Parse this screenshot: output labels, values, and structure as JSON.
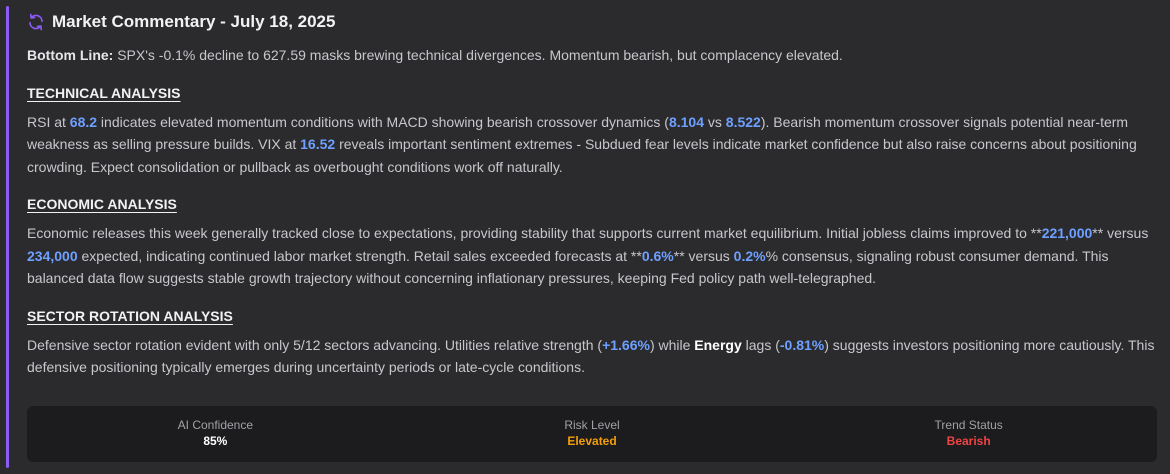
{
  "header": {
    "title": "Market Commentary - July 18, 2025",
    "icon": "refresh-icon",
    "icon_color": "#8b5cf6"
  },
  "bottom_line": {
    "label": "Bottom Line:",
    "text": " SPX's -0.1% decline to 627.59 masks brewing technical divergences. Momentum bearish, but complacency elevated."
  },
  "technical": {
    "title": "TECHNICAL ANALYSIS",
    "t1": "RSI at ",
    "rsi": "68.2",
    "t2": " indicates elevated momentum conditions with MACD showing bearish crossover dynamics (",
    "macd1": "8.104",
    "t3": " vs ",
    "macd2": "8.522",
    "t4": "). Bearish momentum crossover signals potential near-term weakness as selling pressure builds. VIX at ",
    "vix": "16.52",
    "t5": " reveals important sentiment extremes - Subdued fear levels indicate market confidence but also raise concerns about positioning crowding. Expect consolidation or pullback as overbought conditions work off naturally."
  },
  "economic": {
    "title": "ECONOMIC ANALYSIS",
    "t1": "Economic releases this week generally tracked close to expectations, providing stability that supports current market equilibrium. Initial jobless claims improved to **",
    "claims": "221,000",
    "t2": "** versus ",
    "claims_exp": "234,000",
    "t3": " expected, indicating continued labor market strength. Retail sales exceeded forecasts at **",
    "retail": "0.6%",
    "t4": "** versus ",
    "retail_exp": "0.2%",
    "t5": "% consensus, signaling robust consumer demand. This balanced data flow suggests stable growth trajectory without concerning inflationary pressures, keeping Fed policy path well-telegraphed."
  },
  "sector": {
    "title": "SECTOR ROTATION ANALYSIS",
    "t1": "Defensive sector rotation evident with only 5/12 sectors advancing. Utilities relative strength (",
    "util": "+1.66%",
    "t2": ") while ",
    "energy_label": "Energy",
    "t3": " lags (",
    "energy": "-0.81%",
    "t4": ") suggests investors positioning more cautiously. This defensive positioning typically emerges during uncertainty periods or late-cycle conditions."
  },
  "metrics": [
    {
      "label": "AI Confidence",
      "value": "85%",
      "color": "#ffffff"
    },
    {
      "label": "Risk Level",
      "value": "Elevated",
      "color": "#f59e0b"
    },
    {
      "label": "Trend Status",
      "value": "Bearish",
      "color": "#ef4444"
    }
  ]
}
